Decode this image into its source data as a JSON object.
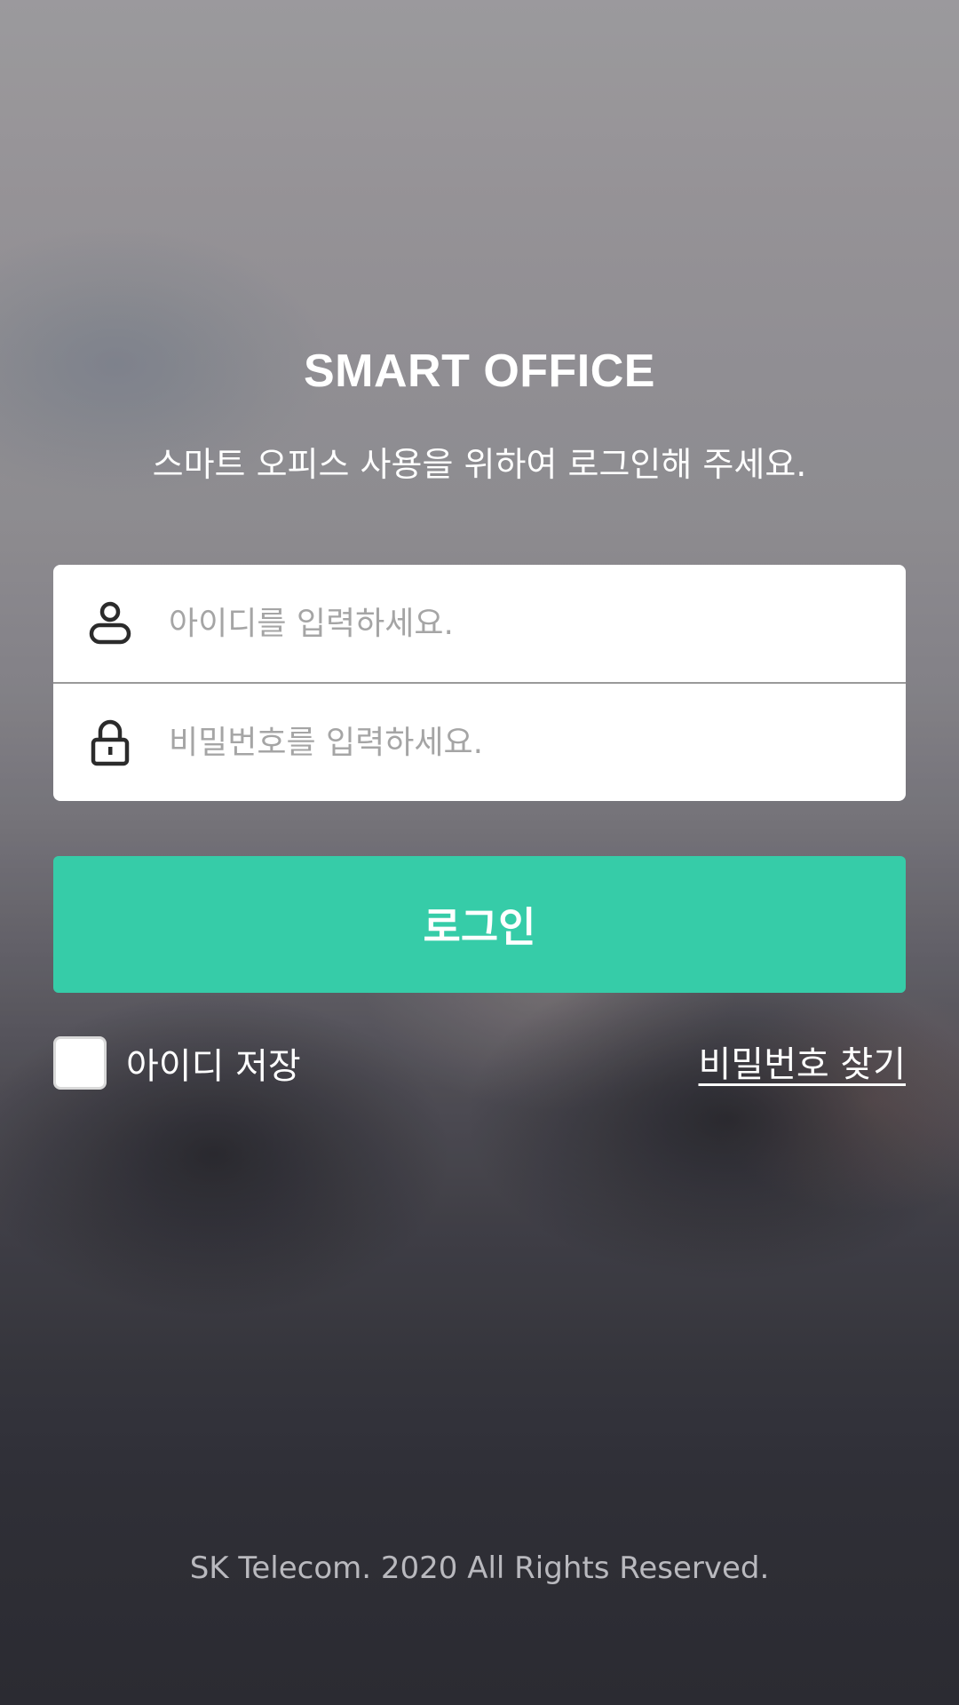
{
  "header": {
    "title": "SMART OFFICE",
    "subtitle": "스마트 오피스 사용을 위하여 로그인해 주세요."
  },
  "form": {
    "id_field": {
      "icon": "user-icon",
      "placeholder": "아이디를 입력하세요.",
      "value": ""
    },
    "password_field": {
      "icon": "lock-icon",
      "placeholder": "비밀번호를 입력하세요.",
      "value": ""
    },
    "login_label": "로그인"
  },
  "options": {
    "save_id_label": "아이디 저장",
    "save_id_checked": false,
    "find_password_label": "비밀번호 찾기"
  },
  "footer": {
    "copyright": "SK Telecom. 2020 All Rights Reserved."
  },
  "colors": {
    "accent": "#36cca8",
    "card": "#ffffff",
    "placeholder": "#a5a5a5"
  }
}
